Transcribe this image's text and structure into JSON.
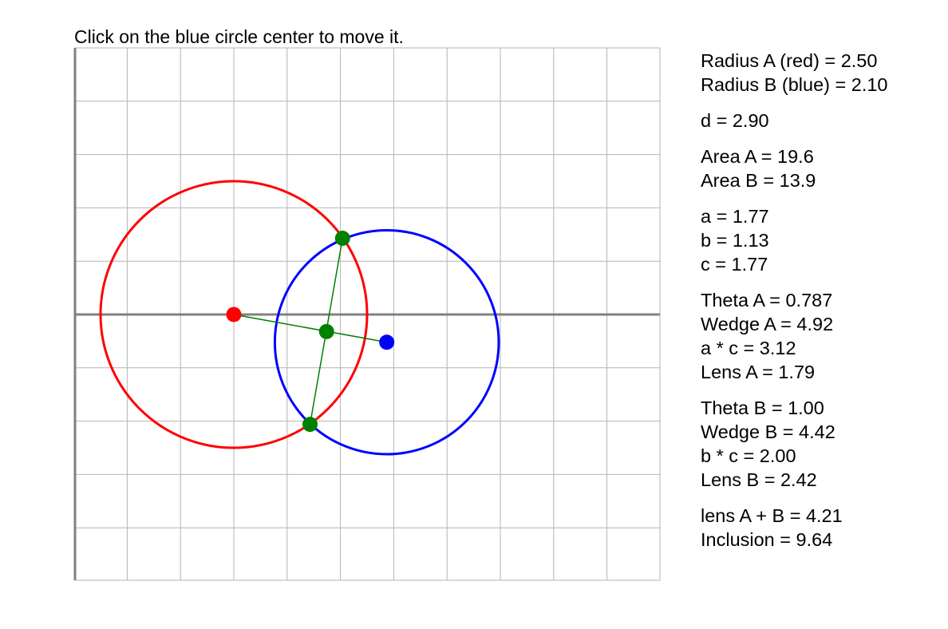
{
  "instruction": "Click on the blue circle center to move it.",
  "colors": {
    "circle_a": "#ff0000",
    "circle_b": "#0000ff",
    "construction": "#008000",
    "grid": "#b4b4b4",
    "axis": "#808080"
  },
  "geometry": {
    "grid_units_per_cell": 1,
    "x_range": [
      -3,
      8
    ],
    "y_range": [
      -5,
      5
    ],
    "circle_a": {
      "center": [
        0,
        0
      ],
      "radius": 2.5
    },
    "circle_b": {
      "center": [
        2.87,
        -0.52
      ],
      "radius": 2.1
    },
    "intersection_1": [
      2.04,
      1.43
    ],
    "intersection_2": [
      1.43,
      -2.06
    ],
    "chord_midpoint": [
      1.74,
      -0.32
    ]
  },
  "readout": {
    "groups": [
      [
        "Radius A (red) = 2.50",
        "Radius B (blue) = 2.10"
      ],
      [
        "d = 2.90"
      ],
      [
        "Area A = 19.6",
        "Area B = 13.9"
      ],
      [
        "a = 1.77",
        "b = 1.13",
        "c = 1.77"
      ],
      [
        "Theta A = 0.787",
        "Wedge A = 4.92",
        "a * c = 3.12",
        "Lens A = 1.79"
      ],
      [
        "Theta B = 1.00",
        "Wedge B = 4.42",
        "b * c = 2.00",
        "Lens B = 2.42"
      ],
      [
        "lens A + B = 4.21",
        "Inclusion = 9.64"
      ]
    ]
  }
}
